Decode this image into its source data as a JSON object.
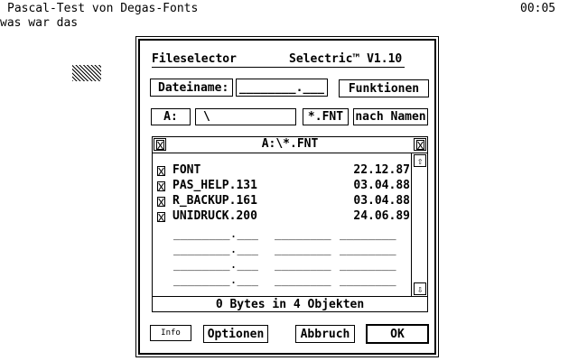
{
  "screen": {
    "top_left_line1": "Pascal-Test von Degas-Fonts",
    "top_left_line2": "was war das",
    "clock": "00:05"
  },
  "dialog": {
    "title": "Fileselector",
    "version": "Selectric™ V1.10",
    "filename_label": "Dateiname:",
    "filename_value": "________.___",
    "functions_button": "Funktionen",
    "drive_button": "A:",
    "path_value": "\\",
    "mask_button": "*.FNT",
    "sort_button": "nach Namen",
    "list_path": "A:\\*.FNT",
    "files": [
      {
        "name": "FONT",
        "date": "22.12.87"
      },
      {
        "name": "PAS_HELP.131",
        "date": "03.04.88"
      },
      {
        "name": "R_BACKUP.161",
        "date": "03.04.88"
      },
      {
        "name": "UNIDRUCK.200",
        "date": "24.06.89"
      }
    ],
    "empty_slot": {
      "name": "________.___",
      "size": "________",
      "date": "________"
    },
    "status": "0 Bytes in 4 Objekten",
    "info_button": "Info",
    "options_button": "Optionen",
    "cancel_button": "Abbruch",
    "ok_button": "OK"
  }
}
